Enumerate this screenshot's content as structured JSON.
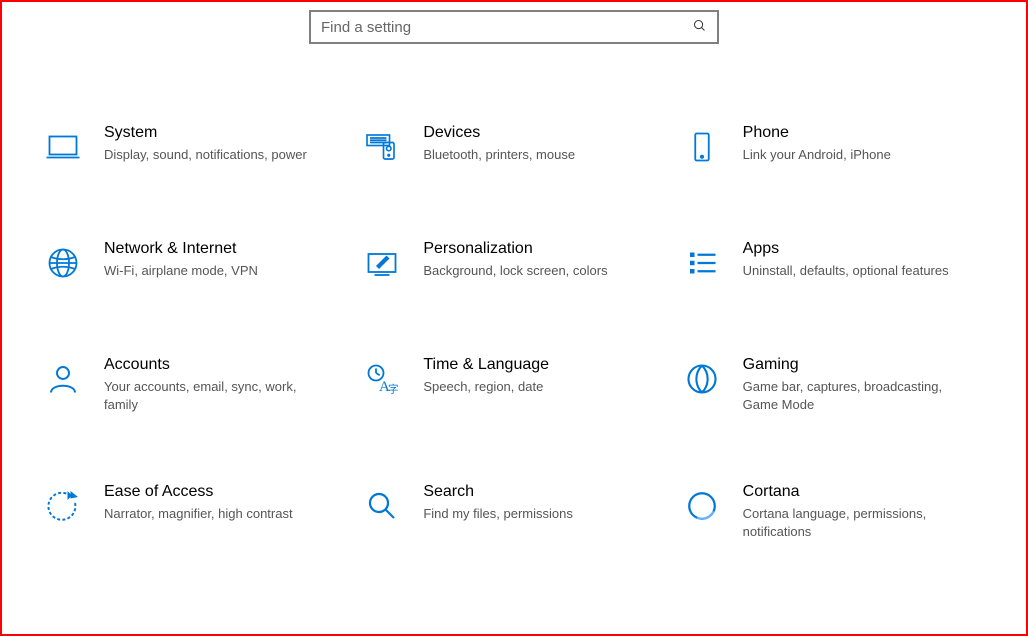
{
  "search": {
    "placeholder": "Find a setting"
  },
  "tiles": {
    "system": {
      "title": "System",
      "desc": "Display, sound, notifications, power"
    },
    "devices": {
      "title": "Devices",
      "desc": "Bluetooth, printers, mouse"
    },
    "phone": {
      "title": "Phone",
      "desc": "Link your Android, iPhone"
    },
    "network": {
      "title": "Network & Internet",
      "desc": "Wi-Fi, airplane mode, VPN"
    },
    "personalization": {
      "title": "Personalization",
      "desc": "Background, lock screen, colors"
    },
    "apps": {
      "title": "Apps",
      "desc": "Uninstall, defaults, optional features"
    },
    "accounts": {
      "title": "Accounts",
      "desc": "Your accounts, email, sync, work, family"
    },
    "time": {
      "title": "Time & Language",
      "desc": "Speech, region, date"
    },
    "gaming": {
      "title": "Gaming",
      "desc": "Game bar, captures, broadcasting, Game Mode"
    },
    "ease": {
      "title": "Ease of Access",
      "desc": "Narrator, magnifier, high contrast"
    },
    "search": {
      "title": "Search",
      "desc": "Find my files, permissions"
    },
    "cortana": {
      "title": "Cortana",
      "desc": "Cortana language, permissions, notifications"
    }
  },
  "colors": {
    "accent": "#0078D7"
  }
}
